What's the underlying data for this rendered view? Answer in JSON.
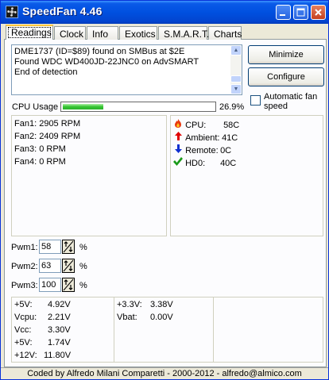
{
  "window": {
    "title": "SpeedFan 4.46"
  },
  "tabs": [
    {
      "label": "Readings"
    },
    {
      "label": "Clock"
    },
    {
      "label": "Info"
    },
    {
      "label": "Exotics"
    },
    {
      "label": "S.M.A.R.T."
    },
    {
      "label": "Charts"
    }
  ],
  "log": [
    "DME1737 (ID=$89) found on SMBus at $2E",
    "Found WDC WD400JD-22JNC0 on AdvSMART",
    "End of detection"
  ],
  "buttons": {
    "minimize": "Minimize",
    "configure": "Configure"
  },
  "auto_fan": {
    "label_line1": "Automatic fan",
    "label_line2": "speed",
    "checked": false
  },
  "cpu_usage": {
    "label": "CPU Usage",
    "value_text": "26.9%",
    "fraction": 0.269
  },
  "fans": [
    {
      "label": "Fan1:",
      "value": "2905 RPM"
    },
    {
      "label": "Fan2:",
      "value": "2409 RPM"
    },
    {
      "label": "Fan3:",
      "value": "0 RPM"
    },
    {
      "label": "Fan4:",
      "value": "0 RPM"
    }
  ],
  "temps": [
    {
      "icon": "flame-icon",
      "label": "CPU:",
      "value": "58C"
    },
    {
      "icon": "arrow-up-icon",
      "label": "Ambient:",
      "value": "41C"
    },
    {
      "icon": "arrow-down-icon",
      "label": "Remote:",
      "value": "0C"
    },
    {
      "icon": "checkmark-icon",
      "label": "HD0:",
      "value": "40C"
    }
  ],
  "pwm": [
    {
      "label": "Pwm1:",
      "value": "58",
      "unit": "%"
    },
    {
      "label": "Pwm2:",
      "value": "63",
      "unit": "%"
    },
    {
      "label": "Pwm3:",
      "value": "100",
      "unit": "%"
    }
  ],
  "voltages_col1": [
    {
      "label": "+5V:",
      "value": "4.92V"
    },
    {
      "label": "Vcpu:",
      "value": "2.21V"
    },
    {
      "label": "Vcc:",
      "value": "3.30V"
    },
    {
      "label": "+5V:",
      "value": "1.74V"
    },
    {
      "label": "+12V:",
      "value": "11.80V"
    }
  ],
  "voltages_col2": [
    {
      "label": "+3.3V:",
      "value": "3.38V"
    },
    {
      "label": "Vbat:",
      "value": "0.00V"
    }
  ],
  "status": {
    "text": "Coded by Alfredo Milani Comparetti - 2000-2012 - alfredo@almico.com"
  },
  "colors": {
    "titlebar": "#0a5ae8",
    "progress": "#36c432",
    "flame": "#e83a10",
    "arrow_up": "#e00000",
    "arrow_down": "#1030d0",
    "check": "#1a9a1a"
  }
}
